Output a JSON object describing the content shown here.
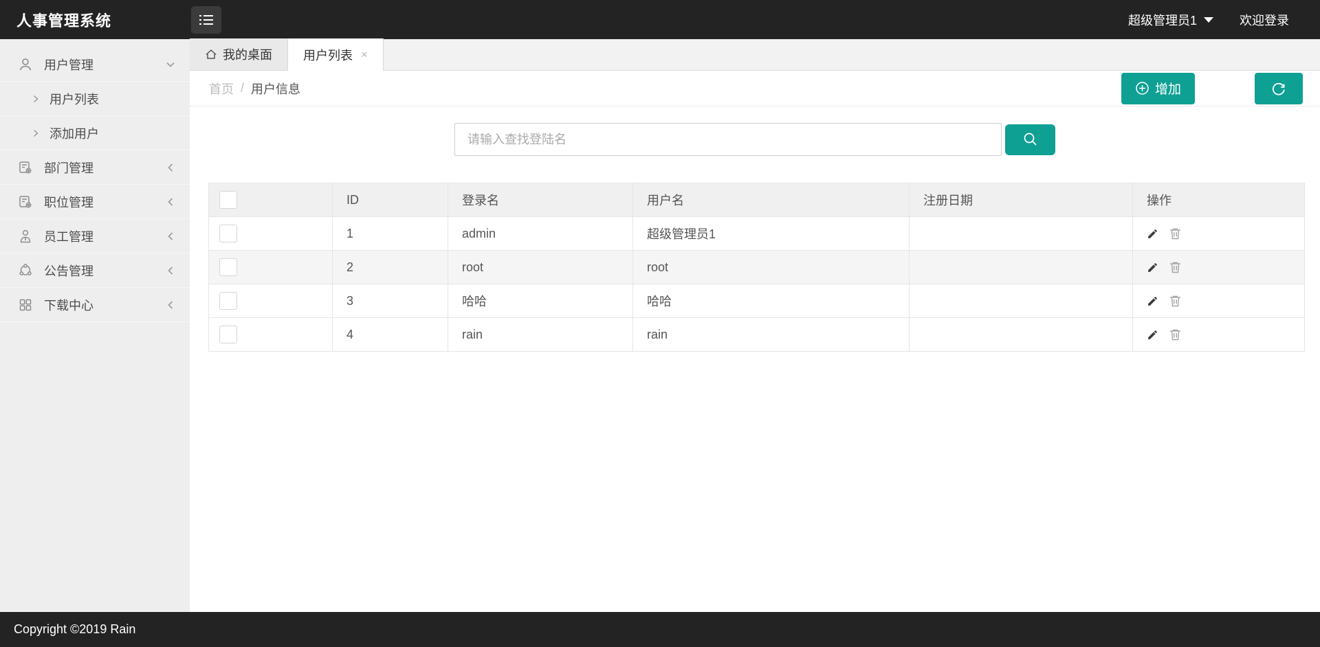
{
  "app": {
    "title": "人事管理系统",
    "footer": "Copyright ©2019 Rain"
  },
  "header": {
    "user": "超级管理员1",
    "welcome": "欢迎登录",
    "hamburger_icon": "menu-list-icon"
  },
  "sidebar": {
    "items": [
      {
        "label": "用户管理",
        "icon": "user-icon",
        "state": "expanded",
        "children": [
          {
            "label": "用户列表"
          },
          {
            "label": "添加用户"
          }
        ]
      },
      {
        "label": "部门管理",
        "icon": "document-gear-icon",
        "state": "collapsed"
      },
      {
        "label": "职位管理",
        "icon": "document-gear-icon",
        "state": "collapsed"
      },
      {
        "label": "员工管理",
        "icon": "employee-icon",
        "state": "collapsed"
      },
      {
        "label": "公告管理",
        "icon": "share-nodes-icon",
        "state": "collapsed"
      },
      {
        "label": "下载中心",
        "icon": "grid-icon",
        "state": "collapsed"
      }
    ]
  },
  "tabs": [
    {
      "label": "我的桌面",
      "icon": "home-icon",
      "active": false
    },
    {
      "label": "用户列表",
      "active": true,
      "close": "×"
    }
  ],
  "breadcrumb": {
    "root": "首页",
    "separator": "/",
    "current": "用户信息"
  },
  "toolbar": {
    "add_label": "增加",
    "add_icon": "plus-circle-icon",
    "refresh_icon": "refresh-icon"
  },
  "search": {
    "placeholder": "请输入查找登陆名",
    "value": "",
    "button_icon": "magnifier-icon"
  },
  "table": {
    "columns": [
      "",
      "ID",
      "登录名",
      "用户名",
      "注册日期",
      "操作"
    ],
    "rows": [
      {
        "id": "1",
        "login": "admin",
        "username": "超级管理员1",
        "reg_date": "",
        "striped": false
      },
      {
        "id": "2",
        "login": "root",
        "username": "root",
        "reg_date": "",
        "striped": true
      },
      {
        "id": "3",
        "login": "哈哈",
        "username": "哈哈",
        "reg_date": "",
        "striped": false
      },
      {
        "id": "4",
        "login": "rain",
        "username": "rain",
        "reg_date": "",
        "striped": false
      }
    ],
    "row_action_icons": [
      "pencil-icon",
      "trash-icon"
    ]
  },
  "colors": {
    "accent": "#0fa094",
    "header_bg": "#232323",
    "sidebar_bg": "#eeeeee",
    "table_header_bg": "#f0f0f0",
    "stripe": "#f5f5f5"
  }
}
